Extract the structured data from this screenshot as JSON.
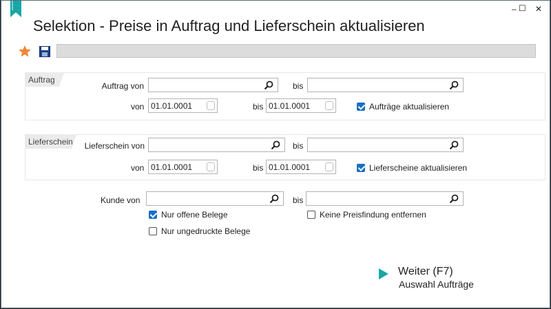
{
  "window": {
    "title": "Selektion - Preise in Auftrag und Lieferschein aktualisieren",
    "minimize": "–",
    "maximize": "☐",
    "close": "✕"
  },
  "colors": {
    "accent": "#1aa6a6",
    "star": "#f0883a",
    "check": "#1a6fc4"
  },
  "auftrag": {
    "group_label": "Auftrag",
    "von_label": "Auftrag von",
    "von_value": "",
    "bis_label": "bis",
    "bis_value": "",
    "date_von_label": "von",
    "date_von": "01.01.0001",
    "date_bis_label": "bis",
    "date_bis": "01.01.0001",
    "update_label": "Aufträge aktualisieren",
    "update_checked": true
  },
  "lieferschein": {
    "group_label": "Lieferschein",
    "von_label": "Lieferschein von",
    "von_value": "",
    "bis_label": "bis",
    "bis_value": "",
    "date_von_label": "von",
    "date_von": "01.01.0001",
    "date_bis_label": "bis",
    "date_bis": "01.01.0001",
    "update_label": "Lieferscheine aktualisieren",
    "update_checked": true
  },
  "kunde": {
    "von_label": "Kunde von",
    "von_value": "",
    "bis_label": "bis",
    "bis_value": ""
  },
  "options": {
    "nur_offene": "Nur offene Belege",
    "nur_offene_checked": true,
    "nur_ungedruckte": "Nur ungedruckte Belege",
    "nur_ungedruckte_checked": false,
    "keine_preisfindung": "Keine Preisfindung entfernen",
    "keine_preisfindung_checked": false
  },
  "next": {
    "title": "Weiter (F7)",
    "subtitle": "Auswahl Aufträge"
  },
  "icons": [
    "bookmark-icon",
    "star-icon",
    "save-icon",
    "search-icon",
    "calendar-icon",
    "play-icon"
  ]
}
